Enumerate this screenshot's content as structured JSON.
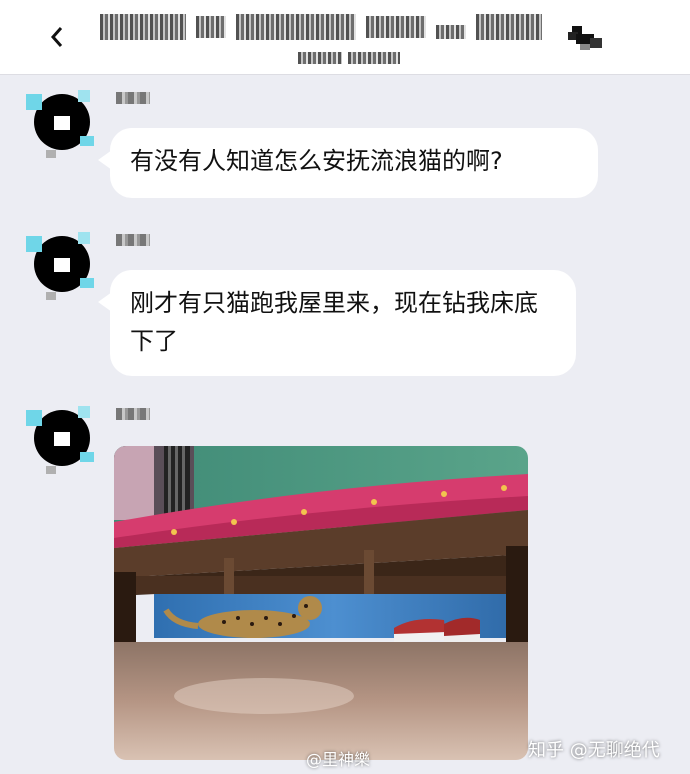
{
  "messages": [
    {
      "text": "有没有人知道怎么安抚流浪猫的啊?"
    },
    {
      "text": "刚才有只猫跑我屋里来，现在钻我床底下了"
    }
  ],
  "watermark": {
    "weibo": "@里神樂",
    "zhihu": "知乎 @无聊绝代"
  },
  "photo_icons": {
    "back": "chevron-left-icon",
    "menu": "more-icon"
  }
}
